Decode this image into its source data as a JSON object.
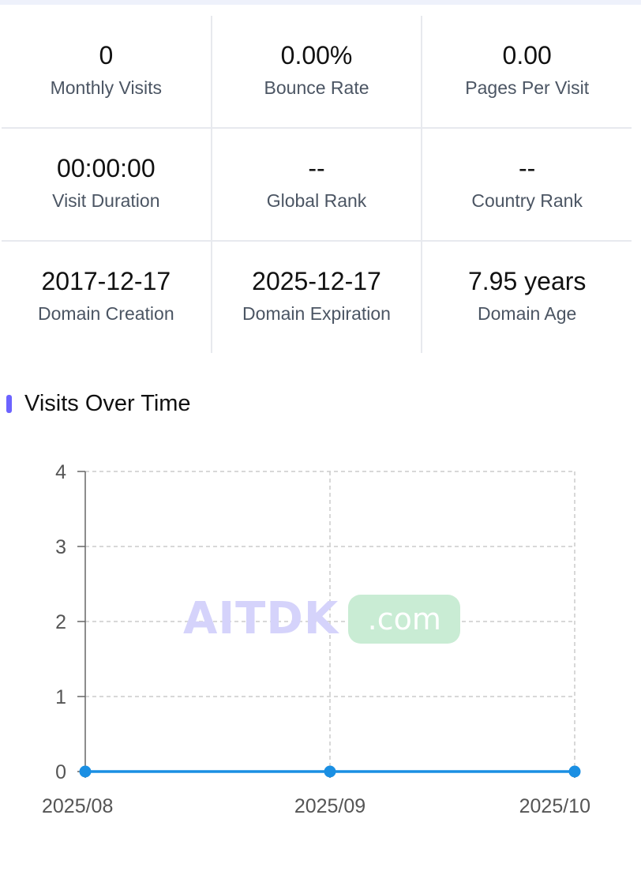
{
  "stats": [
    [
      {
        "value": "0",
        "label": "Monthly Visits"
      },
      {
        "value": "0.00%",
        "label": "Bounce Rate"
      },
      {
        "value": "0.00",
        "label": "Pages Per Visit"
      }
    ],
    [
      {
        "value": "00:00:00",
        "label": "Visit Duration"
      },
      {
        "value": "--",
        "label": "Global Rank"
      },
      {
        "value": "--",
        "label": "Country Rank"
      }
    ],
    [
      {
        "value": "2017-12-17",
        "label": "Domain Creation"
      },
      {
        "value": "2025-12-17",
        "label": "Domain Expiration"
      },
      {
        "value": "7.95 years",
        "label": "Domain Age"
      }
    ]
  ],
  "section": {
    "title": "Visits Over Time"
  },
  "watermark": {
    "text": "AITDK",
    "badge": ".com"
  },
  "colors": {
    "accent": "#6c63ff",
    "line": "#1a8fe3",
    "grid": "#cccccc"
  },
  "chart_data": {
    "type": "line",
    "categories": [
      "2025/08",
      "2025/09",
      "2025/10"
    ],
    "series": [
      {
        "values": [
          0,
          0,
          0
        ]
      }
    ],
    "yticks": [
      0,
      1,
      2,
      3,
      4
    ],
    "ylim": [
      0,
      4
    ],
    "grid": true,
    "title": "",
    "xlabel": "",
    "ylabel": ""
  }
}
